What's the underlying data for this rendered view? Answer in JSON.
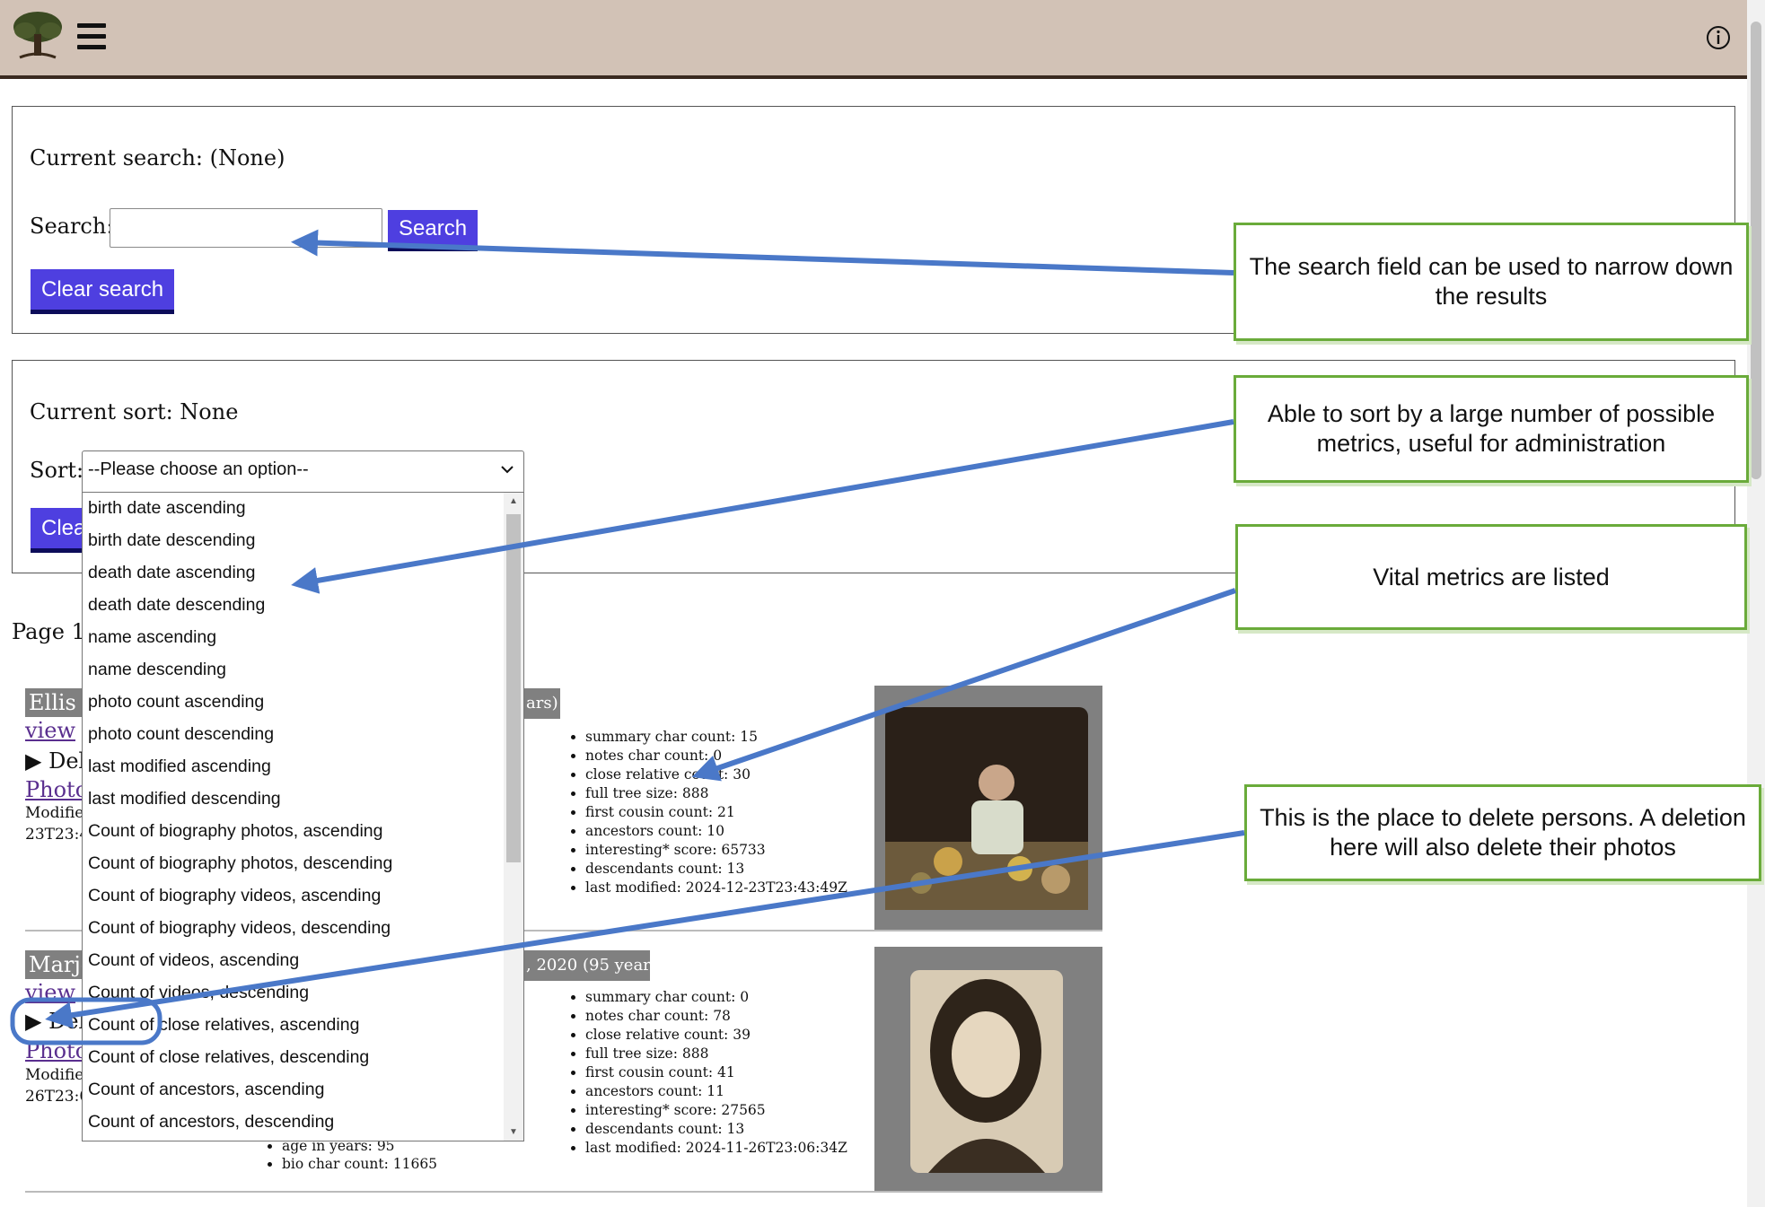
{
  "header": {
    "logo": "tree-icon",
    "menu_icon": "hamburger-icon",
    "info_icon": "info-icon"
  },
  "search_box": {
    "current_label": "Current search: (None)",
    "search_label": "Search:",
    "search_value": "",
    "search_button": "Search",
    "clear_button": "Clear search"
  },
  "sort_box": {
    "current_label": "Current sort: None",
    "sort_label": "Sort:",
    "selected": "--Please choose an option--",
    "clear_button_partial": "Clea",
    "options": [
      "birth date ascending",
      "birth date descending",
      "death date ascending",
      "death date descending",
      "name ascending",
      "name descending",
      "photo count ascending",
      "photo count descending",
      "last modified ascending",
      "last modified descending",
      "Count of biography photos, ascending",
      "Count of biography photos, descending",
      "Count of biography videos, ascending",
      "Count of biography videos, descending",
      "Count of videos, ascending",
      "Count of videos, descending",
      "Count of close relatives, ascending",
      "Count of close relatives, descending",
      "Count of ancestors, ascending",
      "Count of ancestors, descending"
    ]
  },
  "page_label": "Page 1",
  "persons": [
    {
      "name_partial": "Ellis",
      "dates_partial": "ars)",
      "view": "view",
      "delete": "Dele",
      "photos": "Photo",
      "modified_label": "Modifie",
      "modified_partial": "23T23:4",
      "metrics": [
        "summary char count: 15",
        "notes char count: 0",
        "close relative count: 30",
        "full tree size: 888",
        "first cousin count: 21",
        "ancestors count: 10",
        "interesting* score: 65733",
        "descendants count: 13",
        "last modified: 2024-12-23T23:43:49Z"
      ]
    },
    {
      "name_partial": "Marjo",
      "dates_partial": ", 2020 (95 years)",
      "view": "view",
      "delete": "Del",
      "photos": "Photo",
      "modified_label": "Modifie",
      "modified_partial": "26T23:0",
      "extra": [
        "age in years: 95",
        "bio char count: 11665"
      ],
      "metrics": [
        "summary char count: 0",
        "notes char count: 78",
        "close relative count: 39",
        "full tree size: 888",
        "first cousin count: 41",
        "ancestors count: 11",
        "interesting* score: 27565",
        "descendants count: 13",
        "last modified: 2024-11-26T23:06:34Z"
      ]
    }
  ],
  "callouts": {
    "search": "The search field can be used to narrow down the results",
    "sort": "Able to sort by a large number of possible metrics, useful for administration",
    "metrics": "Vital metrics are listed",
    "delete": "This is the place to delete persons.  A deletion here will also delete their photos"
  },
  "colors": {
    "button": "#4e3fe0",
    "header": "#d2c2b6",
    "callout_border": "#6aab3a",
    "arrow": "#4a78c8"
  }
}
